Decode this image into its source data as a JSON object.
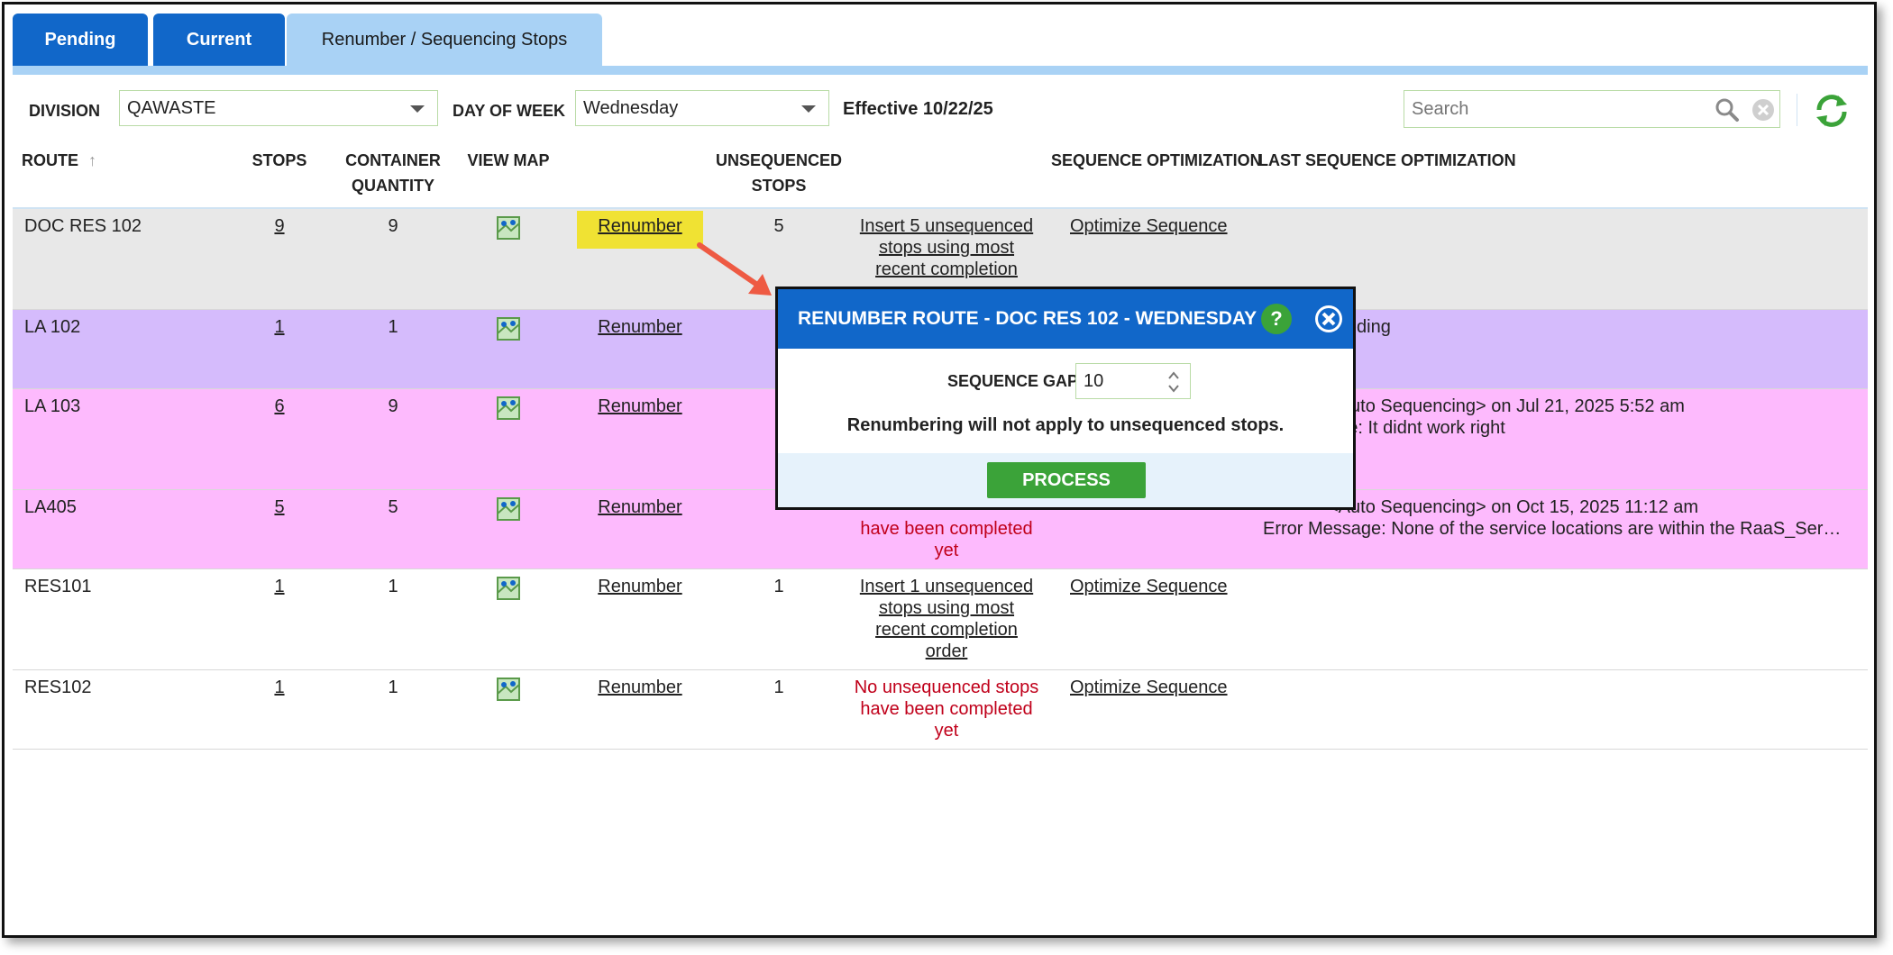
{
  "tabs": [
    {
      "label": "Pending"
    },
    {
      "label": "Current"
    },
    {
      "label": "Renumber / Sequencing Stops"
    }
  ],
  "toolbar": {
    "division_label": "DIVISION",
    "division_value": "QAWASTE",
    "day_label": "DAY OF WEEK",
    "day_value": "Wednesday",
    "effective": "Effective 10/22/25",
    "search_placeholder": "Search"
  },
  "columns": {
    "route": "ROUTE",
    "stops": "STOPS",
    "container_1": "CONTAINER",
    "container_2": "QUANTITY",
    "view_map": "VIEW MAP",
    "unsequenced_1": "UNSEQUENCED",
    "unsequenced_2": "STOPS",
    "seq_opt": "SEQUENCE OPTIMIZATION",
    "last_seq_opt": "LAST SEQUENCE OPTIMIZATION"
  },
  "rows": [
    {
      "route": "DOC RES 102",
      "stops": "9",
      "qty": "9",
      "renumber": "Renumber",
      "unseq": "5",
      "action_lines": [
        "Insert 5 unsequenced",
        "stops using most",
        "recent completion"
      ],
      "optimize": "Optimize Sequence",
      "last": [
        "",
        ""
      ]
    },
    {
      "route": "LA 102",
      "stops": "1",
      "qty": "1",
      "renumber": "Renumber",
      "unseq": "",
      "action_lines": [],
      "optimize": "",
      "last": [
        "ding",
        ""
      ]
    },
    {
      "route": "LA 103",
      "stops": "6",
      "qty": "9",
      "renumber": "Renumber",
      "unseq": "",
      "action_lines": [],
      "optimize": "",
      "last": [
        "<Auto Sequencing> on Jul 21, 2025 5:52 am",
        "age: It didnt work right"
      ]
    },
    {
      "route": "LA405",
      "stops": "5",
      "qty": "5",
      "renumber": "Renumber",
      "unseq": "",
      "action_lines": [
        "have been completed",
        "yet"
      ],
      "optimize": "",
      "last": [
        "<Auto Sequencing> on Oct 15, 2025 11:12 am",
        "Error Message: None of the service locations are within the RaaS_Ser…"
      ]
    },
    {
      "route": "RES101",
      "stops": "1",
      "qty": "1",
      "renumber": "Renumber",
      "unseq": "1",
      "action_lines": [
        "Insert 1 unsequenced",
        "stops using most",
        "recent completion",
        "order"
      ],
      "optimize": "Optimize Sequence",
      "last": [
        "",
        ""
      ]
    },
    {
      "route": "RES102",
      "stops": "1",
      "qty": "1",
      "renumber": "Renumber",
      "unseq": "1",
      "action_lines": [
        "No unsequenced stops",
        "have been completed",
        "yet"
      ],
      "optimize": "Optimize Sequence",
      "last": [
        "",
        ""
      ]
    }
  ],
  "modal": {
    "title": "RENUMBER ROUTE - DOC RES 102 - WEDNESDAY",
    "help": "?",
    "gap_label": "SEQUENCE GAP",
    "gap_value": "10",
    "note": "Renumbering will not apply to unsequenced stops.",
    "process": "PROCESS"
  },
  "colors": {
    "tab_blue": "#1167c9",
    "tab_active": "#a9d2f5",
    "row_grey": "#e8e8e8",
    "row_purple": "#d5bbfc",
    "row_pink": "#fdbafd",
    "highlight": "#f0e233",
    "error_red": "#c0001a",
    "green": "#3ba339"
  }
}
